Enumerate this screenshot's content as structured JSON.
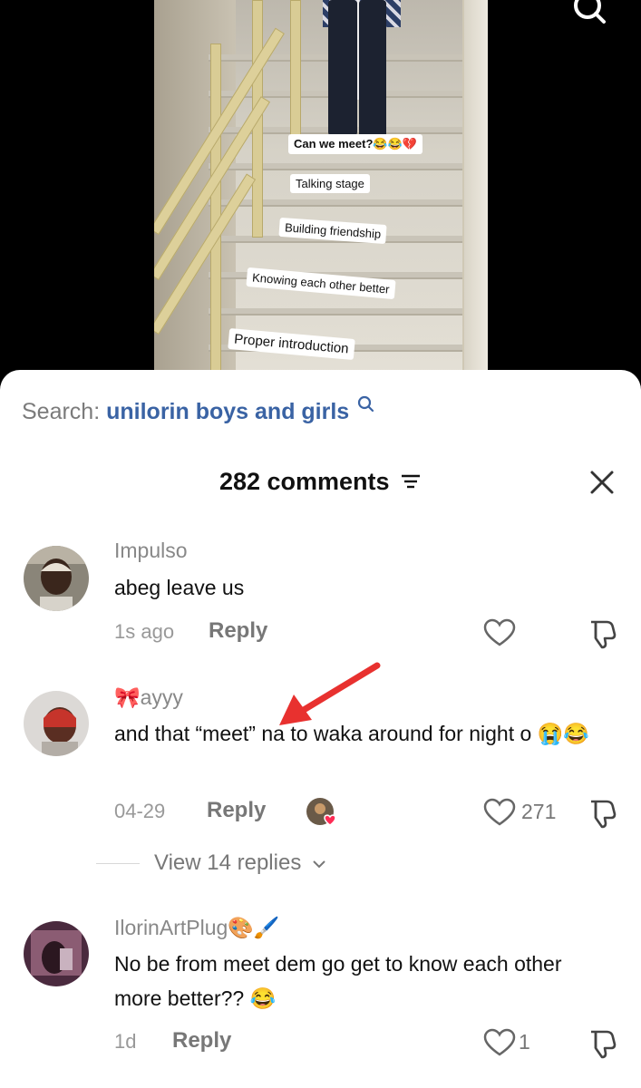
{
  "video": {
    "labels": [
      "Can we meet?😂😂💔",
      "Talking stage",
      "Building friendship",
      "Knowing each other better",
      "Proper introduction"
    ]
  },
  "search": {
    "prefix": "Search:",
    "term": "unilorin boys and girls"
  },
  "header": {
    "title": "282 comments"
  },
  "comments": [
    {
      "username": "Impulso",
      "text": "abeg leave us",
      "time": "1s ago",
      "reply_label": "Reply",
      "likes": ""
    },
    {
      "username": "🎀ayyy",
      "text": "and that “meet” na to waka around for night o 😭😂",
      "time": "04-29",
      "reply_label": "Reply",
      "likes": "271",
      "view_replies": "View 14 replies"
    },
    {
      "username": "IlorinArtPlug🎨🖌️",
      "text": "No be from meet dem go get to know each other more better?? 😂",
      "time": "1d",
      "reply_label": "Reply",
      "likes": "1"
    }
  ],
  "icons": {
    "search": "search-icon",
    "filter": "filter-icon",
    "close": "close-icon",
    "like": "heart-icon",
    "dislike": "thumbs-down-icon"
  },
  "colors": {
    "accent_search": "#3a63a4",
    "annotation_arrow": "#e8312f"
  }
}
